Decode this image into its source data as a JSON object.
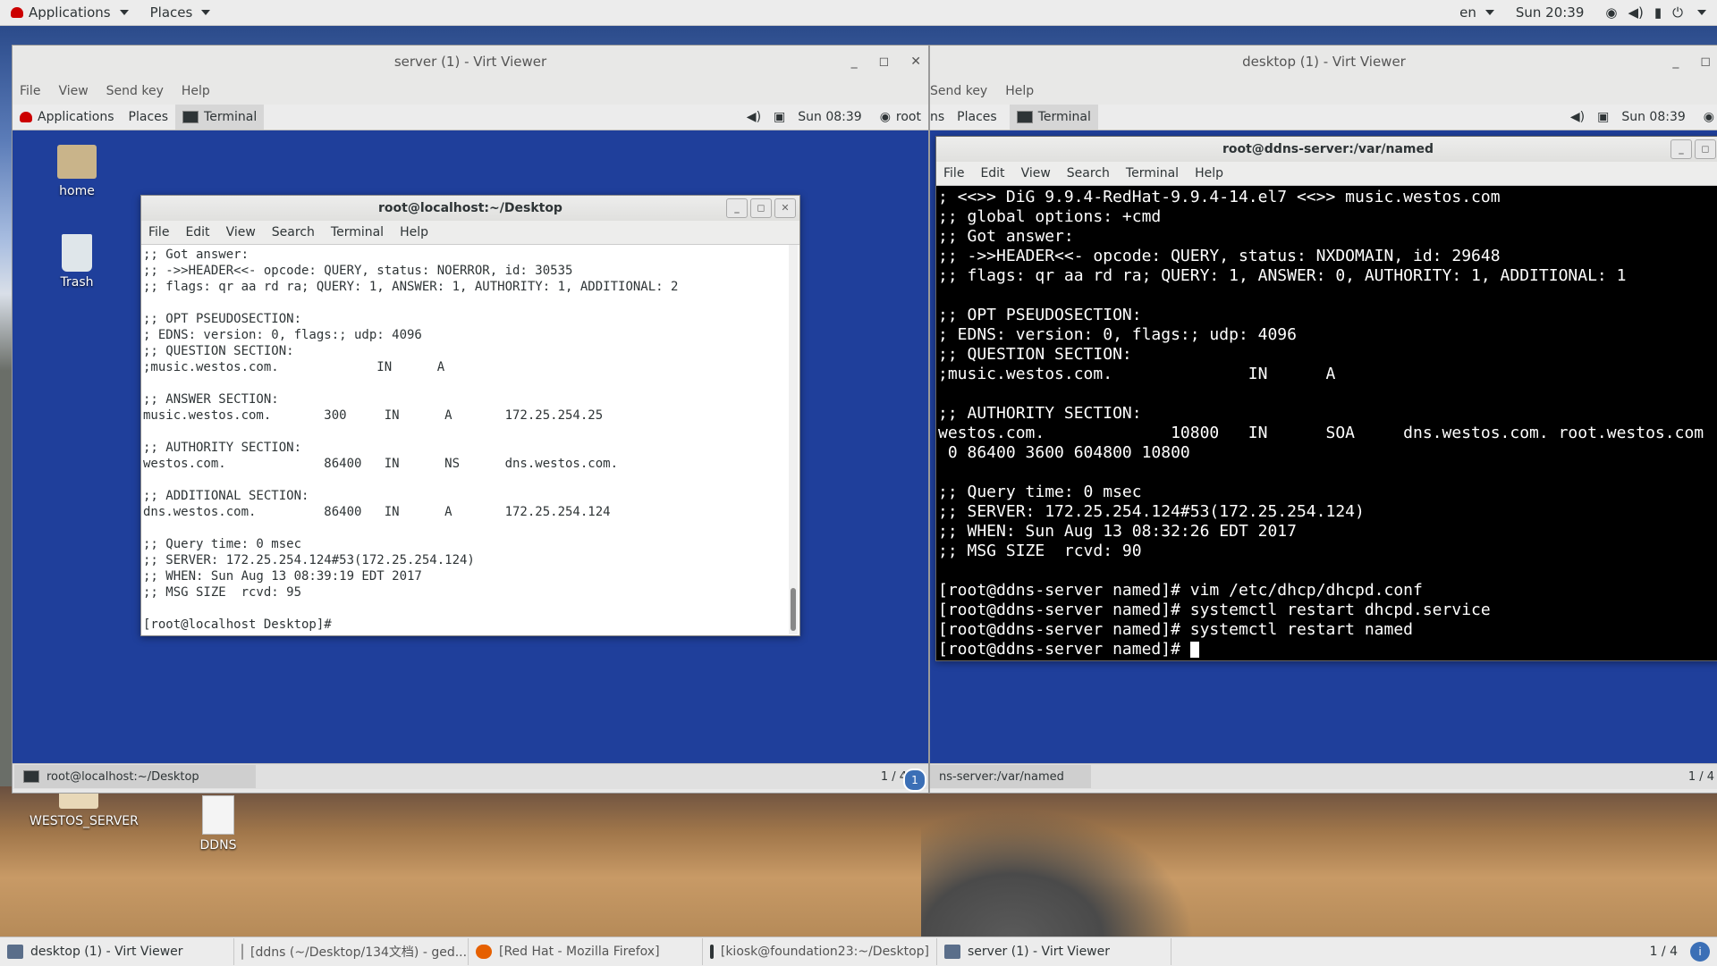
{
  "host_top": {
    "applications": "Applications",
    "places": "Places",
    "lang": "en",
    "clock": "Sun 20:39"
  },
  "desktop_icons": {
    "westos_server": "WESTOS_SERVER",
    "ddns": "DDNS"
  },
  "server_vm": {
    "title": "server (1) - Virt Viewer",
    "menu": [
      "File",
      "View",
      "Send key",
      "Help"
    ],
    "panel": {
      "applications": "Applications",
      "places": "Places",
      "terminal": "Terminal",
      "clock": "Sun 08:39",
      "user": "root"
    },
    "desk_icons": {
      "home": "home",
      "trash": "Trash"
    },
    "terminal": {
      "title": "root@localhost:~/Desktop",
      "menu": [
        "File",
        "Edit",
        "View",
        "Search",
        "Terminal",
        "Help"
      ],
      "lines": [
        ";; Got answer:",
        ";; ->>HEADER<<- opcode: QUERY, status: NOERROR, id: 30535",
        ";; flags: qr aa rd ra; QUERY: 1, ANSWER: 1, AUTHORITY: 1, ADDITIONAL: 2",
        "",
        ";; OPT PSEUDOSECTION:",
        "; EDNS: version: 0, flags:; udp: 4096",
        ";; QUESTION SECTION:",
        ";music.westos.com.             IN      A",
        "",
        ";; ANSWER SECTION:",
        "music.westos.com.       300     IN      A       172.25.254.25",
        "",
        ";; AUTHORITY SECTION:",
        "westos.com.             86400   IN      NS      dns.westos.com.",
        "",
        ";; ADDITIONAL SECTION:",
        "dns.westos.com.         86400   IN      A       172.25.254.124",
        "",
        ";; Query time: 0 msec",
        ";; SERVER: 172.25.254.124#53(172.25.254.124)",
        ";; WHEN: Sun Aug 13 08:39:19 EDT 2017",
        ";; MSG SIZE  rcvd: 95",
        "",
        "[root@localhost Desktop]#"
      ]
    },
    "taskbar_entry": "root@localhost:~/Desktop",
    "workspace": "1 / 4"
  },
  "desktop_vm": {
    "title": "desktop (1) - Virt Viewer",
    "menu": [
      "Send key",
      "Help"
    ],
    "panel": {
      "places_partial": "ns",
      "places": "Places",
      "terminal": "Terminal",
      "clock": "Sun 08:39"
    },
    "terminal": {
      "title": "root@ddns-server:/var/named",
      "menu": [
        "File",
        "Edit",
        "View",
        "Search",
        "Terminal",
        "Help"
      ],
      "lines": [
        "; <<>> DiG 9.9.4-RedHat-9.9.4-14.el7 <<>> music.westos.com",
        ";; global options: +cmd",
        ";; Got answer:",
        ";; ->>HEADER<<- opcode: QUERY, status: NXDOMAIN, id: 29648",
        ";; flags: qr aa rd ra; QUERY: 1, ANSWER: 0, AUTHORITY: 1, ADDITIONAL: 1",
        "",
        ";; OPT PSEUDOSECTION:",
        "; EDNS: version: 0, flags:; udp: 4096",
        ";; QUESTION SECTION:",
        ";music.westos.com.              IN      A",
        "",
        ";; AUTHORITY SECTION:",
        "westos.com.             10800   IN      SOA     dns.westos.com. root.westos.com",
        " 0 86400 3600 604800 10800",
        "",
        ";; Query time: 0 msec",
        ";; SERVER: 172.25.254.124#53(172.25.254.124)",
        ";; WHEN: Sun Aug 13 08:32:26 EDT 2017",
        ";; MSG SIZE  rcvd: 90",
        "",
        "[root@ddns-server named]# vim /etc/dhcp/dhcpd.conf",
        "[root@ddns-server named]# systemctl restart dhcpd.service",
        "[root@ddns-server named]# systemctl restart named",
        "[root@ddns-server named]# "
      ]
    },
    "taskbar_entry": "ns-server:/var/named",
    "workspace": "1 / 4"
  },
  "host_bottom": {
    "items": [
      "desktop (1) - Virt Viewer",
      "[ddns (~/Desktop/134文档) - ged...",
      "[Red Hat - Mozilla Firefox]",
      "[kiosk@foundation23:~/Desktop]",
      "server (1) - Virt Viewer"
    ],
    "workspace": "1 / 4"
  },
  "colors": {
    "guest_desktop": "#1f3f9b",
    "terminal_dark_bg": "#000000",
    "terminal_light_bg": "#ffffff"
  }
}
